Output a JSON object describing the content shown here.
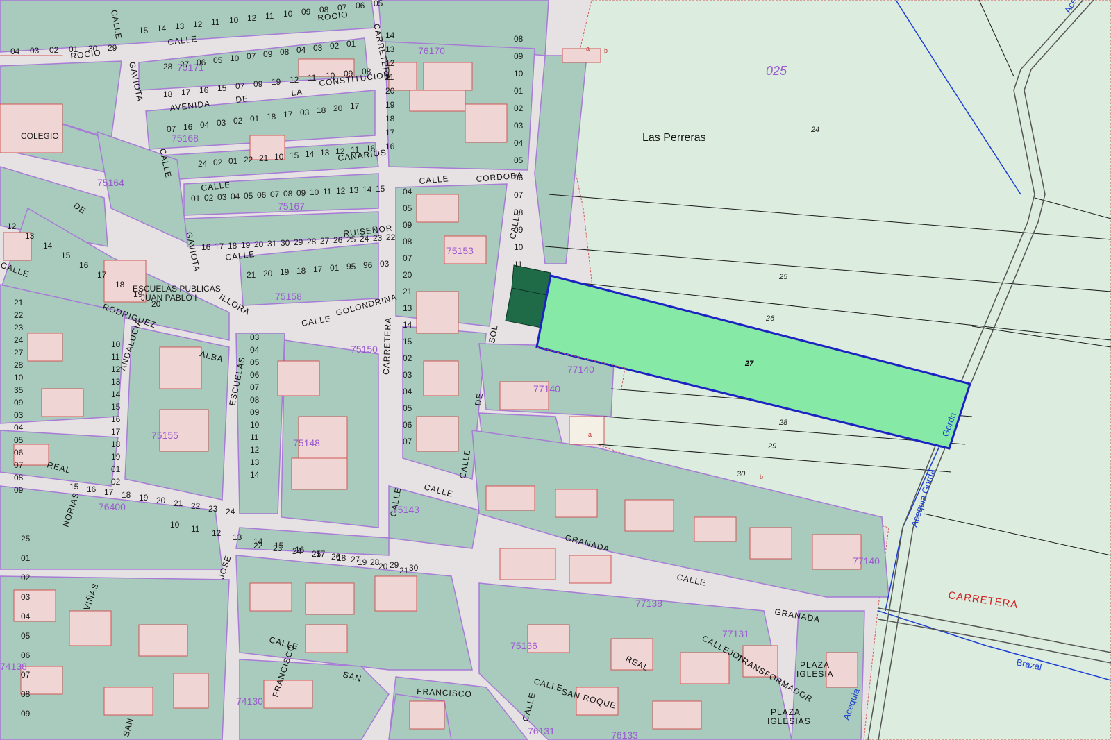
{
  "colors": {
    "block": "#a9cbbd",
    "building": "#f0d5d5",
    "street": "#e6e1e3",
    "rural": "#dcecdf",
    "highlight_fill": "#86eaa6",
    "highlight_border": "#1d22c2",
    "dark_parcels": "#1f6b48",
    "purple_line": "#a77bd6",
    "red_line": "#d25656"
  },
  "street_labels": [
    "CALLE",
    "ROCIO",
    "CALLE",
    "ROCIO",
    "CARRETERA",
    "GAVIOTA",
    "AVENIDA",
    "DE",
    "LA",
    "CONSTITUCION",
    "COLEGIO",
    "CALLE",
    "CANARIOS",
    "CALLE",
    "RUISEÑOR",
    "GAVIOTA",
    "CALLE",
    "DE",
    "CALLE",
    "RODRIGUEZ",
    "ANDALUCIA",
    "ALBA",
    "ESCUELAS",
    "CALLE",
    "GOLONDRINA",
    "CARRETERA",
    "ILLORA",
    "CALLE",
    "CORDOBA",
    "CALLE",
    "SOL",
    "DE",
    "CALLE",
    "CALLE",
    "REAL",
    "CALLE",
    "GRANADA",
    "CALLE",
    "GRANADA",
    "NORIAS",
    "VIÑAS",
    "JOSE",
    "CALLE",
    "FRANCISCO",
    "SAN",
    "FRANCISCO",
    "CALLE",
    "SAN",
    "REAL",
    "CALLEJON",
    "TRANSFORMADOR",
    "PLAZA",
    "IGLESIA",
    "PLAZA",
    "IGLESIAS",
    "CALLE",
    "SAN ROQUE",
    "CARRETERA"
  ],
  "building_labels": [
    "ESCUELAS PUBLICAS",
    "JUAN PABLO I"
  ],
  "block_ids": [
    "76170",
    "75171",
    "75168",
    "75164",
    "75167",
    "75153",
    "75158",
    "75150",
    "77140",
    "77140",
    "75155",
    "75148",
    "75143",
    "76400",
    "77138",
    "77131",
    "75136",
    "74138",
    "74130",
    "76131",
    "76133",
    "77140"
  ],
  "zone_id": "025",
  "place_name": "Las Perreras",
  "parcels": [
    "24",
    "25",
    "26",
    "27",
    "28",
    "29",
    "30"
  ],
  "highlighted_parcel": "27",
  "subparcel_letters": [
    "a",
    "b",
    "a",
    "b"
  ],
  "water_labels": [
    "Acequia",
    "Gorda",
    "Brazal",
    "Acequia",
    "Acequia Gorda"
  ],
  "parcel_numbers": [
    "14",
    "13",
    "12",
    "11",
    "20",
    "19",
    "18",
    "17",
    "16",
    "15",
    "14",
    "13",
    "12",
    "11",
    "10",
    "12",
    "11",
    "10",
    "09",
    "08",
    "07",
    "06",
    "05",
    "04",
    "03",
    "02",
    "01",
    "30",
    "29",
    "28",
    "27",
    "06",
    "05",
    "10",
    "07",
    "09",
    "08",
    "04",
    "03",
    "02",
    "01",
    "18",
    "17",
    "16",
    "15",
    "07",
    "09",
    "19",
    "12",
    "11",
    "10",
    "09",
    "08",
    "07",
    "16",
    "04",
    "03",
    "02",
    "01",
    "18",
    "17",
    "03",
    "18",
    "20",
    "17",
    "24",
    "02",
    "01",
    "22",
    "21",
    "10",
    "15",
    "14",
    "13",
    "12",
    "11",
    "16",
    "01",
    "02",
    "03",
    "04",
    "05",
    "06",
    "07",
    "08",
    "09",
    "10",
    "11",
    "12",
    "13",
    "14",
    "15",
    "16",
    "17",
    "18",
    "19",
    "20",
    "31",
    "30",
    "29",
    "28",
    "27",
    "26",
    "25",
    "24",
    "23",
    "22",
    "21",
    "20",
    "19",
    "18",
    "17",
    "01",
    "95",
    "96",
    "03",
    "04",
    "05",
    "09",
    "08",
    "07",
    "20",
    "21",
    "13",
    "14",
    "15",
    "02",
    "03",
    "04",
    "05",
    "06",
    "07",
    "08",
    "09",
    "10",
    "01",
    "02",
    "03",
    "04",
    "05",
    "06",
    "07",
    "08",
    "09",
    "10",
    "11",
    "12",
    "13",
    "14",
    "15",
    "16",
    "17",
    "18",
    "19",
    "20",
    "21",
    "22",
    "23",
    "24",
    "27",
    "28",
    "10",
    "35",
    "09",
    "03",
    "04",
    "05",
    "06",
    "07",
    "08",
    "09",
    "10",
    "11",
    "12",
    "13",
    "14",
    "15",
    "16",
    "17",
    "18",
    "19",
    "01",
    "02",
    "03",
    "04",
    "05",
    "06",
    "07",
    "08",
    "09",
    "10",
    "11",
    "12",
    "13",
    "14",
    "15",
    "16",
    "17",
    "18",
    "19",
    "20",
    "21",
    "22",
    "23",
    "24",
    "25",
    "01",
    "02",
    "03",
    "04",
    "05",
    "06",
    "07",
    "08",
    "09",
    "10",
    "11",
    "12",
    "13",
    "14",
    "15",
    "16",
    "17",
    "18",
    "19",
    "20",
    "21",
    "22",
    "23",
    "24",
    "25",
    "26",
    "27",
    "28",
    "29",
    "30"
  ]
}
